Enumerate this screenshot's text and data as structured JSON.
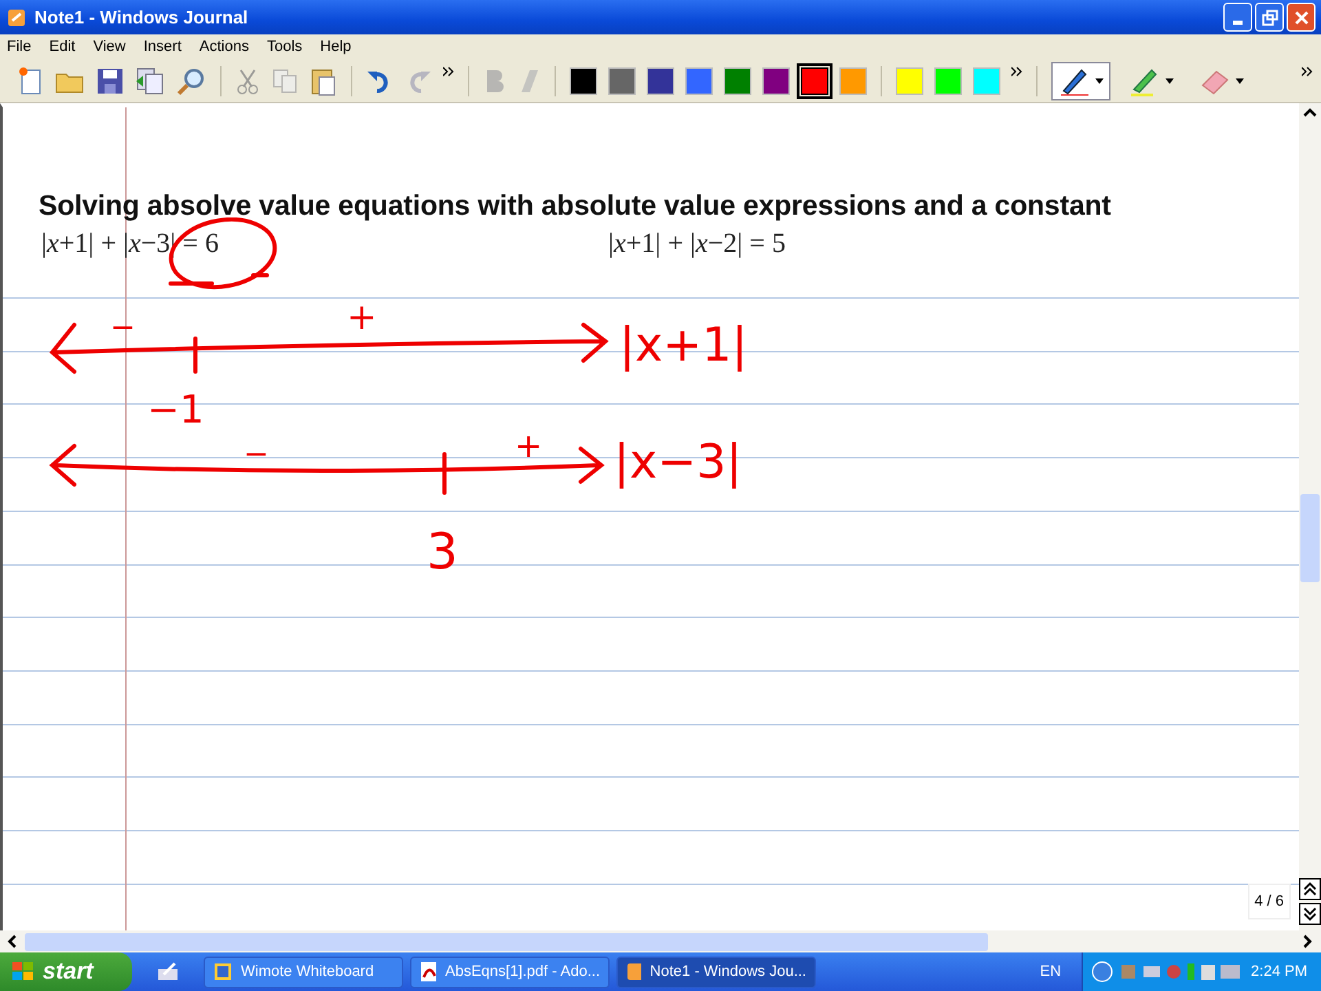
{
  "window": {
    "title": "Note1 - Windows Journal"
  },
  "menu": [
    "File",
    "Edit",
    "View",
    "Insert",
    "Actions",
    "Tools",
    "Help"
  ],
  "toolbar": {
    "pen_colors": [
      {
        "color": "#000000",
        "selected": false
      },
      {
        "color": "#666666",
        "selected": false
      },
      {
        "color": "#333399",
        "selected": false
      },
      {
        "color": "#3366ff",
        "selected": false
      },
      {
        "color": "#008000",
        "selected": false
      },
      {
        "color": "#800080",
        "selected": false
      },
      {
        "color": "#ff0000",
        "selected": true
      },
      {
        "color": "#ff9900",
        "selected": false
      },
      {
        "color": "#ffff00",
        "selected": false
      },
      {
        "color": "#00ff00",
        "selected": false
      },
      {
        "color": "#00ffff",
        "selected": false
      }
    ],
    "tools": [
      {
        "kind": "pen",
        "selected": true
      },
      {
        "kind": "highlighter",
        "selected": false
      },
      {
        "kind": "eraser",
        "selected": false
      }
    ]
  },
  "note": {
    "heading": "Solving absolve value equations with absolute value expressions and a constant",
    "equations": [
      "|*x*+1| + |*x*−3| = 6",
      "|*x*+1| + |*x*−2| = 5"
    ],
    "ink": [
      "−",
      "+",
      "|x+1|",
      "−1",
      "−",
      "+",
      "|x−3|",
      "3"
    ],
    "page_indicator": "4 / 6"
  },
  "taskbar": {
    "start": "start",
    "tasks": [
      {
        "label": "Wimote Whiteboard",
        "kind": "app",
        "selected": false
      },
      {
        "label": "AbsEqns[1].pdf - Ado...",
        "kind": "pdf",
        "selected": false
      },
      {
        "label": "Note1 - Windows Jou...",
        "kind": "journal",
        "selected": true
      }
    ],
    "language": "EN",
    "clock": "2:24 PM"
  }
}
